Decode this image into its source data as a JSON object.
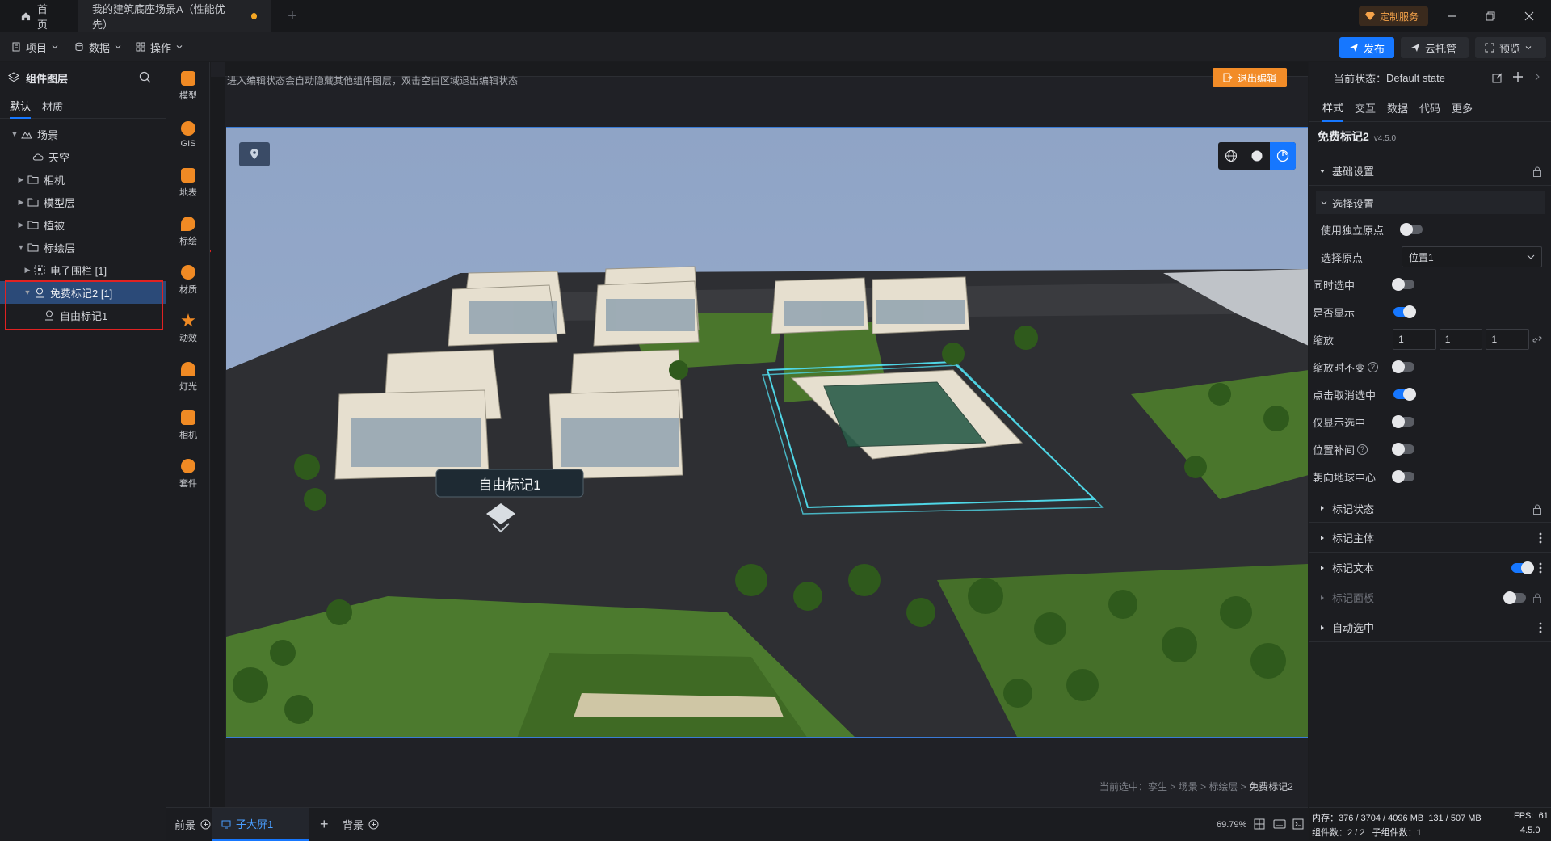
{
  "tabs": {
    "home": "首页",
    "scene": "我的建筑底座场景A（性能优先）"
  },
  "header": {
    "custom_service": "定制服务"
  },
  "menu": {
    "project": "项目",
    "data": "数据",
    "operate": "操作"
  },
  "toolbar": {
    "publish": "发布",
    "cloud": "云托管",
    "preview": "预览"
  },
  "left": {
    "title": "组件图层",
    "tabs": {
      "default": "默认",
      "material": "材质"
    },
    "tree": [
      {
        "label": "场景"
      },
      {
        "label": "天空"
      },
      {
        "label": "相机"
      },
      {
        "label": "模型层"
      },
      {
        "label": "植被"
      },
      {
        "label": "标绘层"
      },
      {
        "label": "电子围栏 [1]"
      },
      {
        "label": "免费标记2 [1]"
      },
      {
        "label": "自由标记1"
      }
    ]
  },
  "tools": [
    {
      "label": "模型",
      "color": "#f08a24"
    },
    {
      "label": "GIS",
      "color": "#f08a24"
    },
    {
      "label": "地表",
      "color": "#f08a24"
    },
    {
      "label": "标绘",
      "color": "#f08a24"
    },
    {
      "label": "材质",
      "color": "#f08a24"
    },
    {
      "label": "动效",
      "color": "#f08a24"
    },
    {
      "label": "灯光",
      "color": "#f08a24"
    },
    {
      "label": "相机",
      "color": "#f08a24"
    },
    {
      "label": "套件",
      "color": "#f08a24"
    }
  ],
  "canvas": {
    "hint": "进入编辑状态会自动隐藏其他组件图层，双击空白区域退出编辑状态",
    "exit_edit": "退出编辑",
    "marker_label": "自由标记1",
    "path_prefix": "当前选中：",
    "path": [
      "孪生",
      "场景",
      "标绘层"
    ],
    "path_current": "免费标记2"
  },
  "bottom": {
    "front": "前景",
    "sub": "子大屏1",
    "back": "背景",
    "zoom": "69.79%"
  },
  "right": {
    "state_label": "当前状态：",
    "state_value": "Default state",
    "tabs": {
      "style": "样式",
      "interact": "交互",
      "data": "数据",
      "code": "代码",
      "more": "更多"
    },
    "component_name": "免费标记2",
    "component_version": "v4.5.0",
    "basic": "基础设置",
    "select_settings": "选择设置",
    "use_origin": "使用独立原点",
    "select_origin": "选择原点",
    "select_origin_value": "位置1",
    "props": {
      "same_select": "同时选中",
      "visible": "是否显示",
      "scale": "缩放",
      "scale_vals": [
        "1",
        "1",
        "1"
      ],
      "scale_fixed": "缩放时不变",
      "click_cancel": "点击取消选中",
      "only_show": "仅显示选中",
      "pos_tween": "位置补间",
      "face_center": "朝向地球中心"
    },
    "sections": {
      "state": "标记状态",
      "body": "标记主体",
      "text": "标记文本",
      "panel": "标记面板",
      "auto_select": "自动选中"
    }
  },
  "status": {
    "memory_label": "内存：",
    "memory": "376 / 3704 / 4096 MB",
    "memory2": "131 / 507 MB",
    "fps_label": "FPS:",
    "fps": "61",
    "components_label": "组件数：",
    "components": "2 / 2",
    "children_label": "子组件数：",
    "children": "1",
    "version": "4.5.0"
  }
}
